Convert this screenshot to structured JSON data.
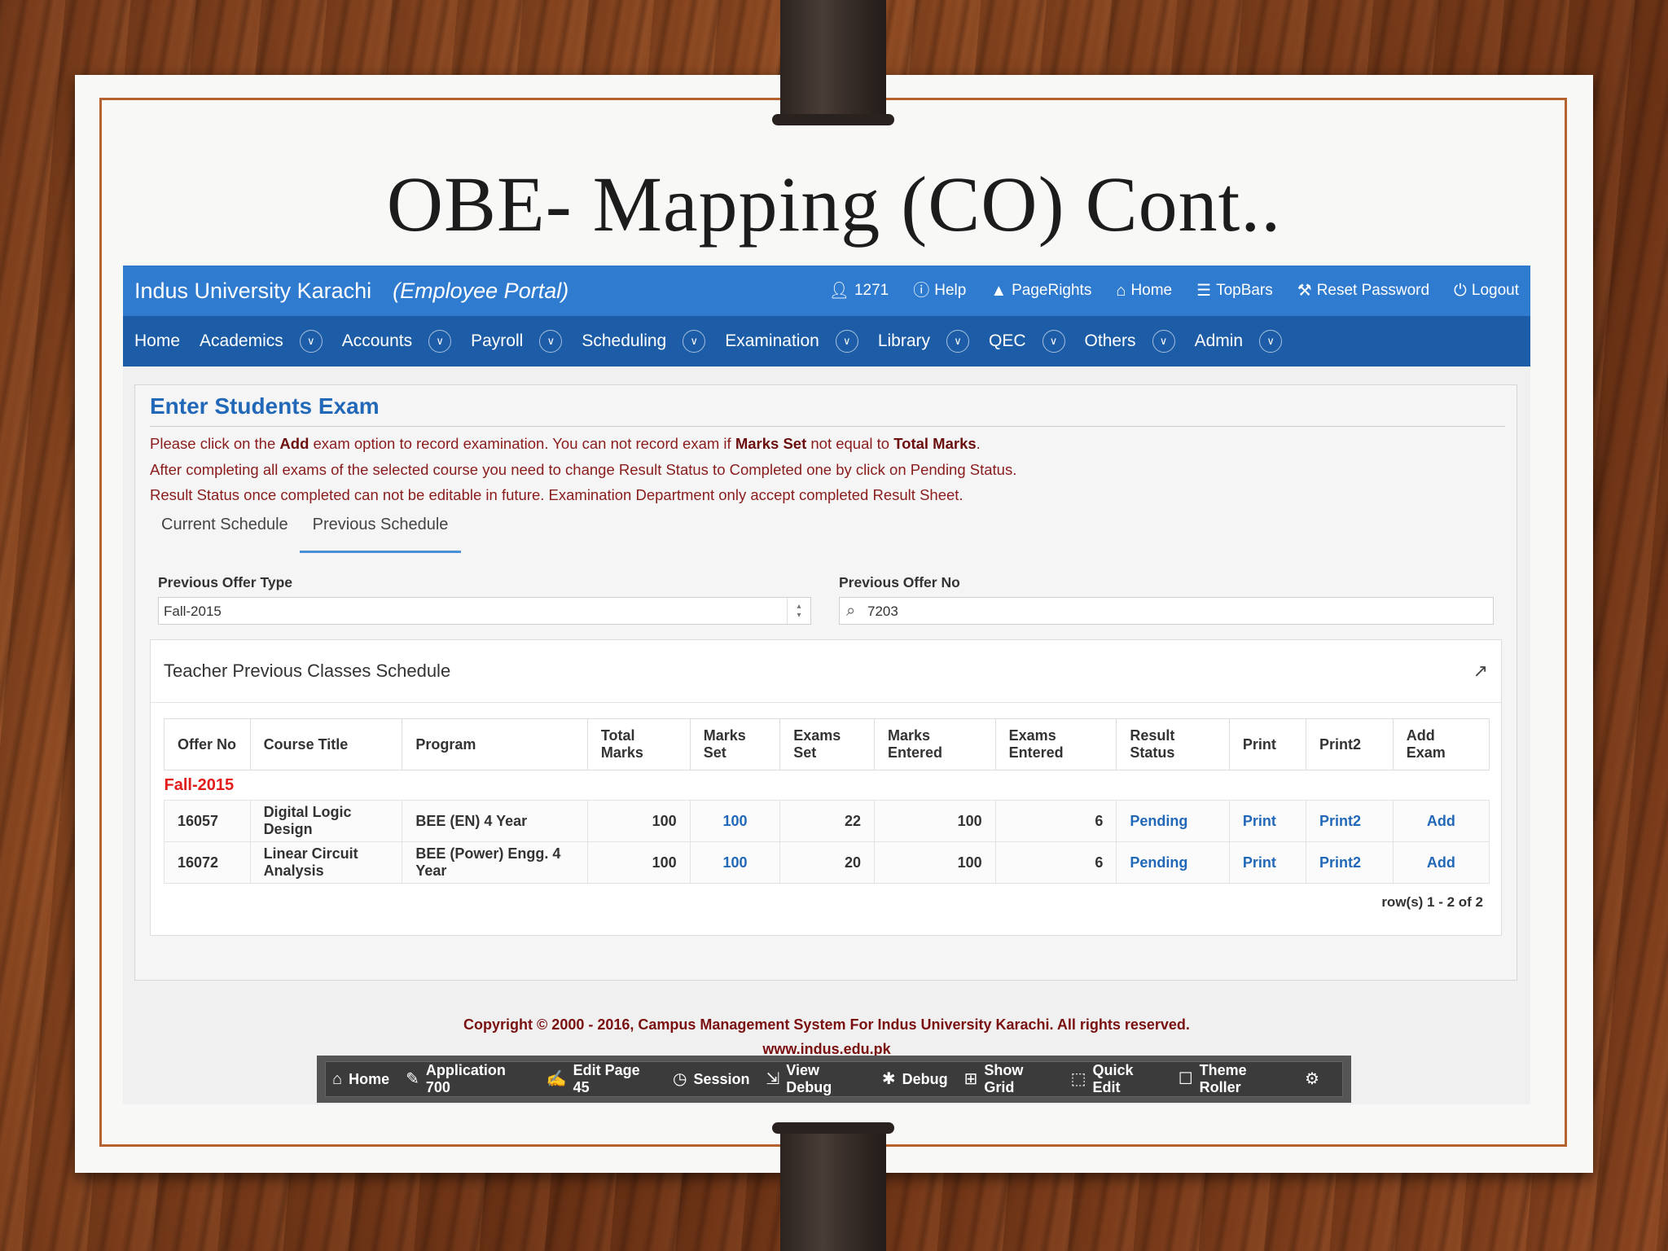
{
  "slide": {
    "title": "OBE- Mapping (CO) Cont.."
  },
  "topbar": {
    "brand": "Indus University Karachi",
    "portal": "(Employee Portal)",
    "links": [
      {
        "label": "1271",
        "icon": "user-icon"
      },
      {
        "label": "Help",
        "icon": "help-icon"
      },
      {
        "label": "PageRights",
        "icon": "user-rights-icon"
      },
      {
        "label": "Home",
        "icon": "home-icon"
      },
      {
        "label": "TopBars",
        "icon": "list-icon"
      },
      {
        "label": "Reset Password",
        "icon": "key-icon"
      },
      {
        "label": "Logout",
        "icon": "power-icon"
      }
    ]
  },
  "nav": {
    "items": [
      {
        "label": "Home"
      },
      {
        "label": "Academics"
      },
      {
        "label": "Accounts"
      },
      {
        "label": "Payroll"
      },
      {
        "label": "Scheduling"
      },
      {
        "label": "Examination"
      },
      {
        "label": "Library"
      },
      {
        "label": "QEC"
      },
      {
        "label": "Others"
      },
      {
        "label": "Admin"
      }
    ]
  },
  "region": {
    "title": "Enter Students Exam",
    "info": {
      "line1_a": "Please click on the ",
      "line1_b": "Add",
      "line1_c": " exam option to record examination. You can not record exam if ",
      "line1_d": "Marks Set",
      "line1_e": " not equal to ",
      "line1_f": "Total Marks",
      "line1_g": ".",
      "line2": "After completing all exams of the selected course you need to change Result Status to Completed one by click on Pending Status.",
      "line3": "Result Status once completed can not be editable in future. Examination Department only accept completed Result Sheet."
    },
    "tabs": [
      {
        "label": "Current Schedule"
      },
      {
        "label": "Previous Schedule"
      }
    ],
    "offer_type": {
      "label": "Previous Offer Type",
      "value": "Fall-2015"
    },
    "offer_no": {
      "label": "Previous Offer No",
      "value": "7203"
    }
  },
  "report": {
    "title": "Teacher Previous Classes Schedule",
    "columns": [
      "Offer No",
      "Course Title",
      "Program",
      "Total Marks",
      "Marks Set",
      "Exams Set",
      "Marks Entered",
      "Exams Entered",
      "Result Status",
      "Print",
      "Print2",
      "Add Exam"
    ],
    "group": "Fall-2015",
    "rows": [
      {
        "offer_no": "16057",
        "course": "Digital Logic Design",
        "program": "BEE (EN) 4 Year",
        "total": "100",
        "marks_set": "100",
        "exams_set": "22",
        "marks_entered": "100",
        "exams_entered": "6",
        "status": "Pending",
        "print": "Print",
        "print2": "Print2",
        "add": "Add"
      },
      {
        "offer_no": "16072",
        "course": "Linear Circuit Analysis",
        "program": "BEE (Power) Engg. 4 Year",
        "total": "100",
        "marks_set": "100",
        "exams_set": "20",
        "marks_entered": "100",
        "exams_entered": "6",
        "status": "Pending",
        "print": "Print",
        "print2": "Print2",
        "add": "Add"
      }
    ],
    "pagination": "row(s) 1 - 2 of 2"
  },
  "footer": {
    "copyright": "Copyright © 2000 - 2016, Campus Management System For Indus University Karachi. All rights reserved.",
    "url": "www.indus.edu.pk"
  },
  "devbar": {
    "items": [
      {
        "label": "Home",
        "icon": "home-icon"
      },
      {
        "label": "Application 700",
        "icon": "edit-icon"
      },
      {
        "label": "Edit Page 45",
        "icon": "edit-page-icon"
      },
      {
        "label": "Session",
        "icon": "clock-icon"
      },
      {
        "label": "View Debug",
        "icon": "pointer-icon"
      },
      {
        "label": "Debug",
        "icon": "bug-icon"
      },
      {
        "label": "Show Grid",
        "icon": "grid-icon"
      },
      {
        "label": "Quick Edit",
        "icon": "select-icon"
      },
      {
        "label": "Theme Roller",
        "icon": "paint-roller-icon"
      }
    ]
  },
  "colors": {
    "topbar": "#2f7bd0",
    "navbar": "#1d5da7",
    "title": "#2168b8",
    "info_text": "#8a1c1c",
    "group_break": "#e21b1b"
  }
}
